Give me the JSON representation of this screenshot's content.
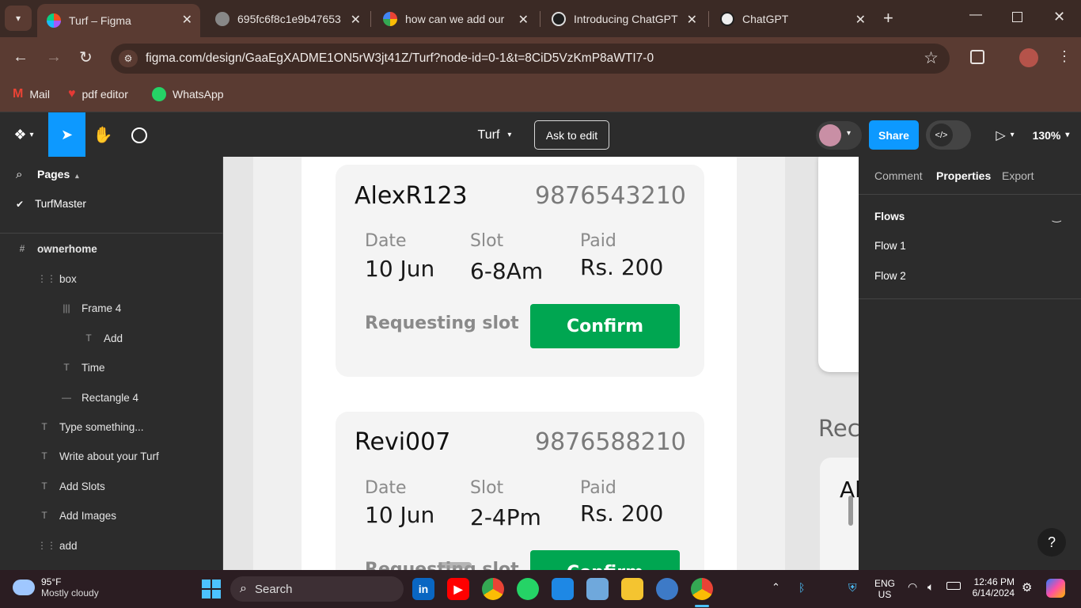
{
  "browser": {
    "tabs": [
      {
        "title": "Turf – Figma",
        "active": true
      },
      {
        "title": "695fc6f8c1e9b47653",
        "active": false
      },
      {
        "title": "how can we add our",
        "active": false
      },
      {
        "title": "Introducing ChatGPT",
        "active": false
      },
      {
        "title": "ChatGPT",
        "active": false
      }
    ],
    "url": "figma.com/design/GaaEgXADME1ON5rW3jt41Z/Turf?node-id=0-1&t=8CiD5VzKmP8aWTI7-0",
    "bookmarks": [
      "Mail",
      "pdf editor",
      "WhatsApp"
    ]
  },
  "figma": {
    "file_name": "Turf",
    "ask_to_edit": "Ask to edit",
    "share": "Share",
    "zoom": "130%"
  },
  "left_panel": {
    "pages_label": "Pages",
    "current_page": "TurfMaster",
    "layers": [
      {
        "name": "ownerhome",
        "icon": "#"
      },
      {
        "name": "box",
        "icon": "⋮⋮"
      },
      {
        "name": "Frame 4",
        "icon": "|||"
      },
      {
        "name": "Add",
        "icon": "T"
      },
      {
        "name": "Time",
        "icon": "T"
      },
      {
        "name": "Rectangle 4",
        "icon": "—"
      },
      {
        "name": "Type something...",
        "icon": "T"
      },
      {
        "name": "Write about your Turf",
        "icon": "T"
      },
      {
        "name": "Add Slots",
        "icon": "T"
      },
      {
        "name": "Add Images",
        "icon": "T"
      },
      {
        "name": "add",
        "icon": "⋮⋮"
      }
    ]
  },
  "canvas": {
    "cards": [
      {
        "user": "AlexR123",
        "phone": "9876543210",
        "date_label": "Date",
        "date": "10 Jun",
        "slot_label": "Slot",
        "slot": "6-8Am",
        "paid_label": "Paid",
        "paid": "Rs. 200",
        "status": "Requesting slot",
        "confirm": "Confirm"
      },
      {
        "user": "Revi007",
        "phone": "9876588210",
        "date_label": "Date",
        "date": "10 Jun",
        "slot_label": "Slot",
        "slot": "2-4Pm",
        "paid_label": "Paid",
        "paid": "Rs. 200",
        "status": "Requesting slot",
        "confirm": "Confirm"
      }
    ],
    "side_heading_partial": "Rec",
    "side_card_partial": "Al"
  },
  "right_panel": {
    "tabs": [
      "Comment",
      "Properties",
      "Export"
    ],
    "active_tab": "Properties",
    "flows_title": "Flows",
    "flows": [
      "Flow 1",
      "Flow 2"
    ],
    "help": "?"
  },
  "taskbar": {
    "weather_temp": "95°F",
    "weather_desc": "Mostly cloudy",
    "search": "Search",
    "lang_top": "ENG",
    "lang_bottom": "US",
    "time": "12:46 PM",
    "date": "6/14/2024"
  }
}
